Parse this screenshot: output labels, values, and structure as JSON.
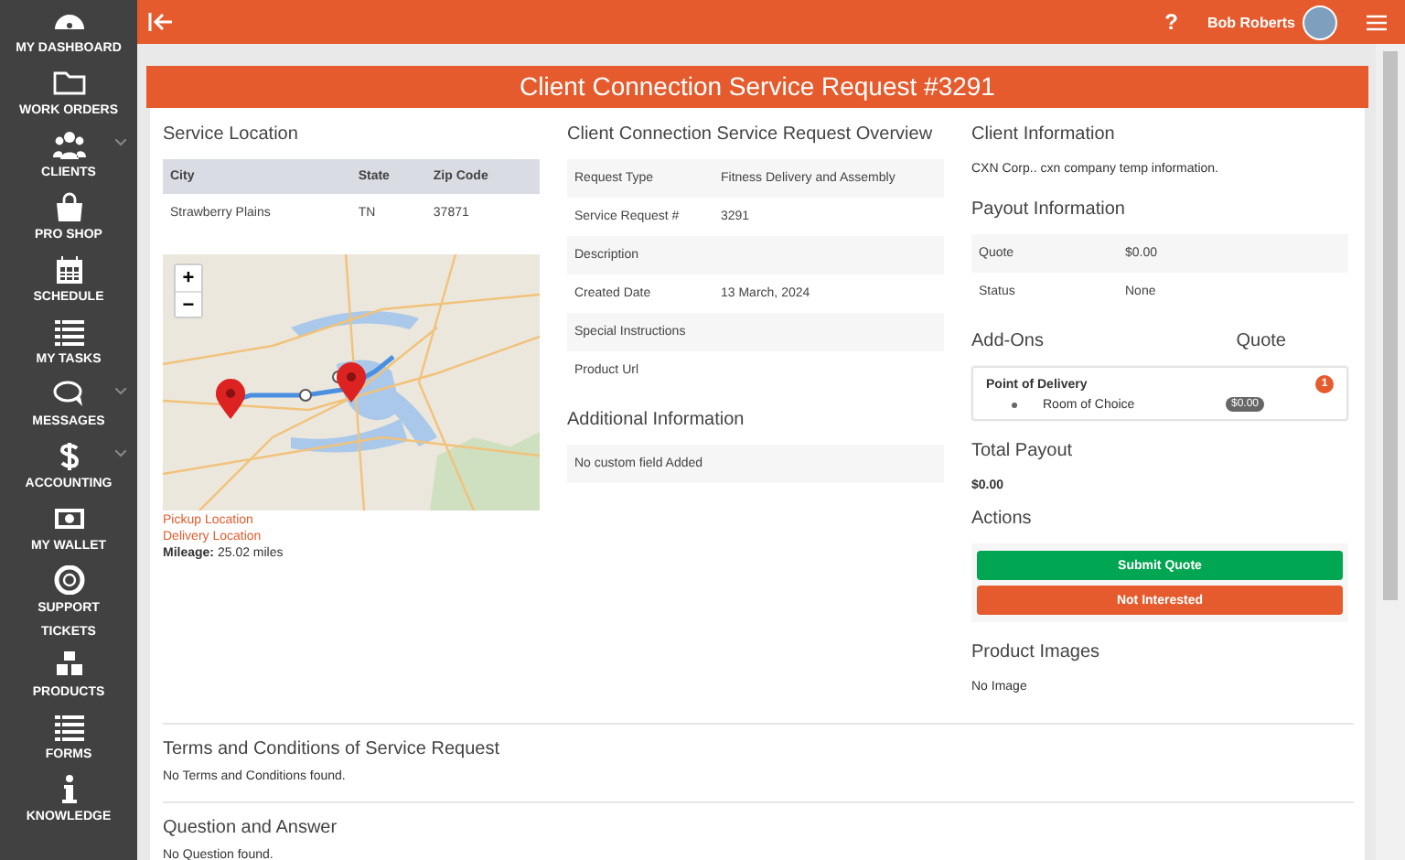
{
  "sidebar": {
    "items": [
      {
        "label": "MY DASHBOARD",
        "has_submenu": false
      },
      {
        "label": "WORK ORDERS",
        "has_submenu": false
      },
      {
        "label": "CLIENTS",
        "has_submenu": true
      },
      {
        "label": "PRO SHOP",
        "has_submenu": false
      },
      {
        "label": "SCHEDULE",
        "has_submenu": false
      },
      {
        "label": "MY TASKS",
        "has_submenu": false
      },
      {
        "label": "MESSAGES",
        "has_submenu": true
      },
      {
        "label": "ACCOUNTING",
        "has_submenu": true
      },
      {
        "label": "MY WALLET",
        "has_submenu": false
      },
      {
        "label": "SUPPORT TICKETS",
        "has_submenu": false
      },
      {
        "label": "PRODUCTS",
        "has_submenu": false
      },
      {
        "label": "FORMS",
        "has_submenu": false
      },
      {
        "label": "KNOWLEDGE",
        "has_submenu": false
      }
    ]
  },
  "topbar": {
    "help": "?",
    "user_name": "Bob Roberts"
  },
  "page_title": "Client Connection Service Request #3291",
  "service_location": {
    "title": "Service Location",
    "columns": [
      "City",
      "State",
      "Zip Code"
    ],
    "row": [
      "Strawberry Plains",
      "TN",
      "37871"
    ],
    "map": {
      "zoom_in": "+",
      "zoom_out": "−"
    },
    "pickup_link": "Pickup Location",
    "delivery_link": "Delivery Location",
    "mileage": "**Mileage:** 25.02 miles"
  },
  "overview": {
    "title": "Client Connection Service Request Overview",
    "rows": [
      {
        "label": "Request Type",
        "value": "Fitness Delivery and Assembly"
      },
      {
        "label": "Service Request #",
        "value": "3291"
      },
      {
        "label": "Description",
        "value": ""
      },
      {
        "label": "Created Date",
        "value": "13 March, 2024"
      },
      {
        "label": "Special Instructions",
        "value": ""
      },
      {
        "label": "Product Url",
        "value": ""
      }
    ]
  },
  "additional_info": {
    "title": "Additional Information",
    "text": "No custom field Added"
  },
  "client_info": {
    "title": "Client Information",
    "text": "CXN Corp.. cxn company temp information."
  },
  "payout": {
    "title": "Payout Information",
    "rows": [
      {
        "label": "Quote",
        "value": "$0.00"
      },
      {
        "label": "Status",
        "value": "None"
      }
    ]
  },
  "addons": {
    "title": "Add-Ons",
    "quote_header": "Quote",
    "groups": [
      {
        "name": "Point of Delivery",
        "count": "1",
        "items": [
          {
            "name": "Room of Choice",
            "price": "$0.00"
          }
        ]
      }
    ]
  },
  "total_payout": {
    "title": "Total Payout",
    "value": "$0.00"
  },
  "actions": {
    "title": "Actions",
    "buttons": [
      {
        "label": "Submit Quote",
        "kind": "submit"
      },
      {
        "label": "Not Interested",
        "kind": "decline"
      }
    ]
  },
  "product_images": {
    "title": "Product Images",
    "text": "No Image"
  },
  "terms": {
    "title": "Terms and Conditions of Service Request",
    "text": "No Terms and Conditions found."
  },
  "qa": {
    "title": "Question and Answer",
    "text": "No Question found."
  }
}
